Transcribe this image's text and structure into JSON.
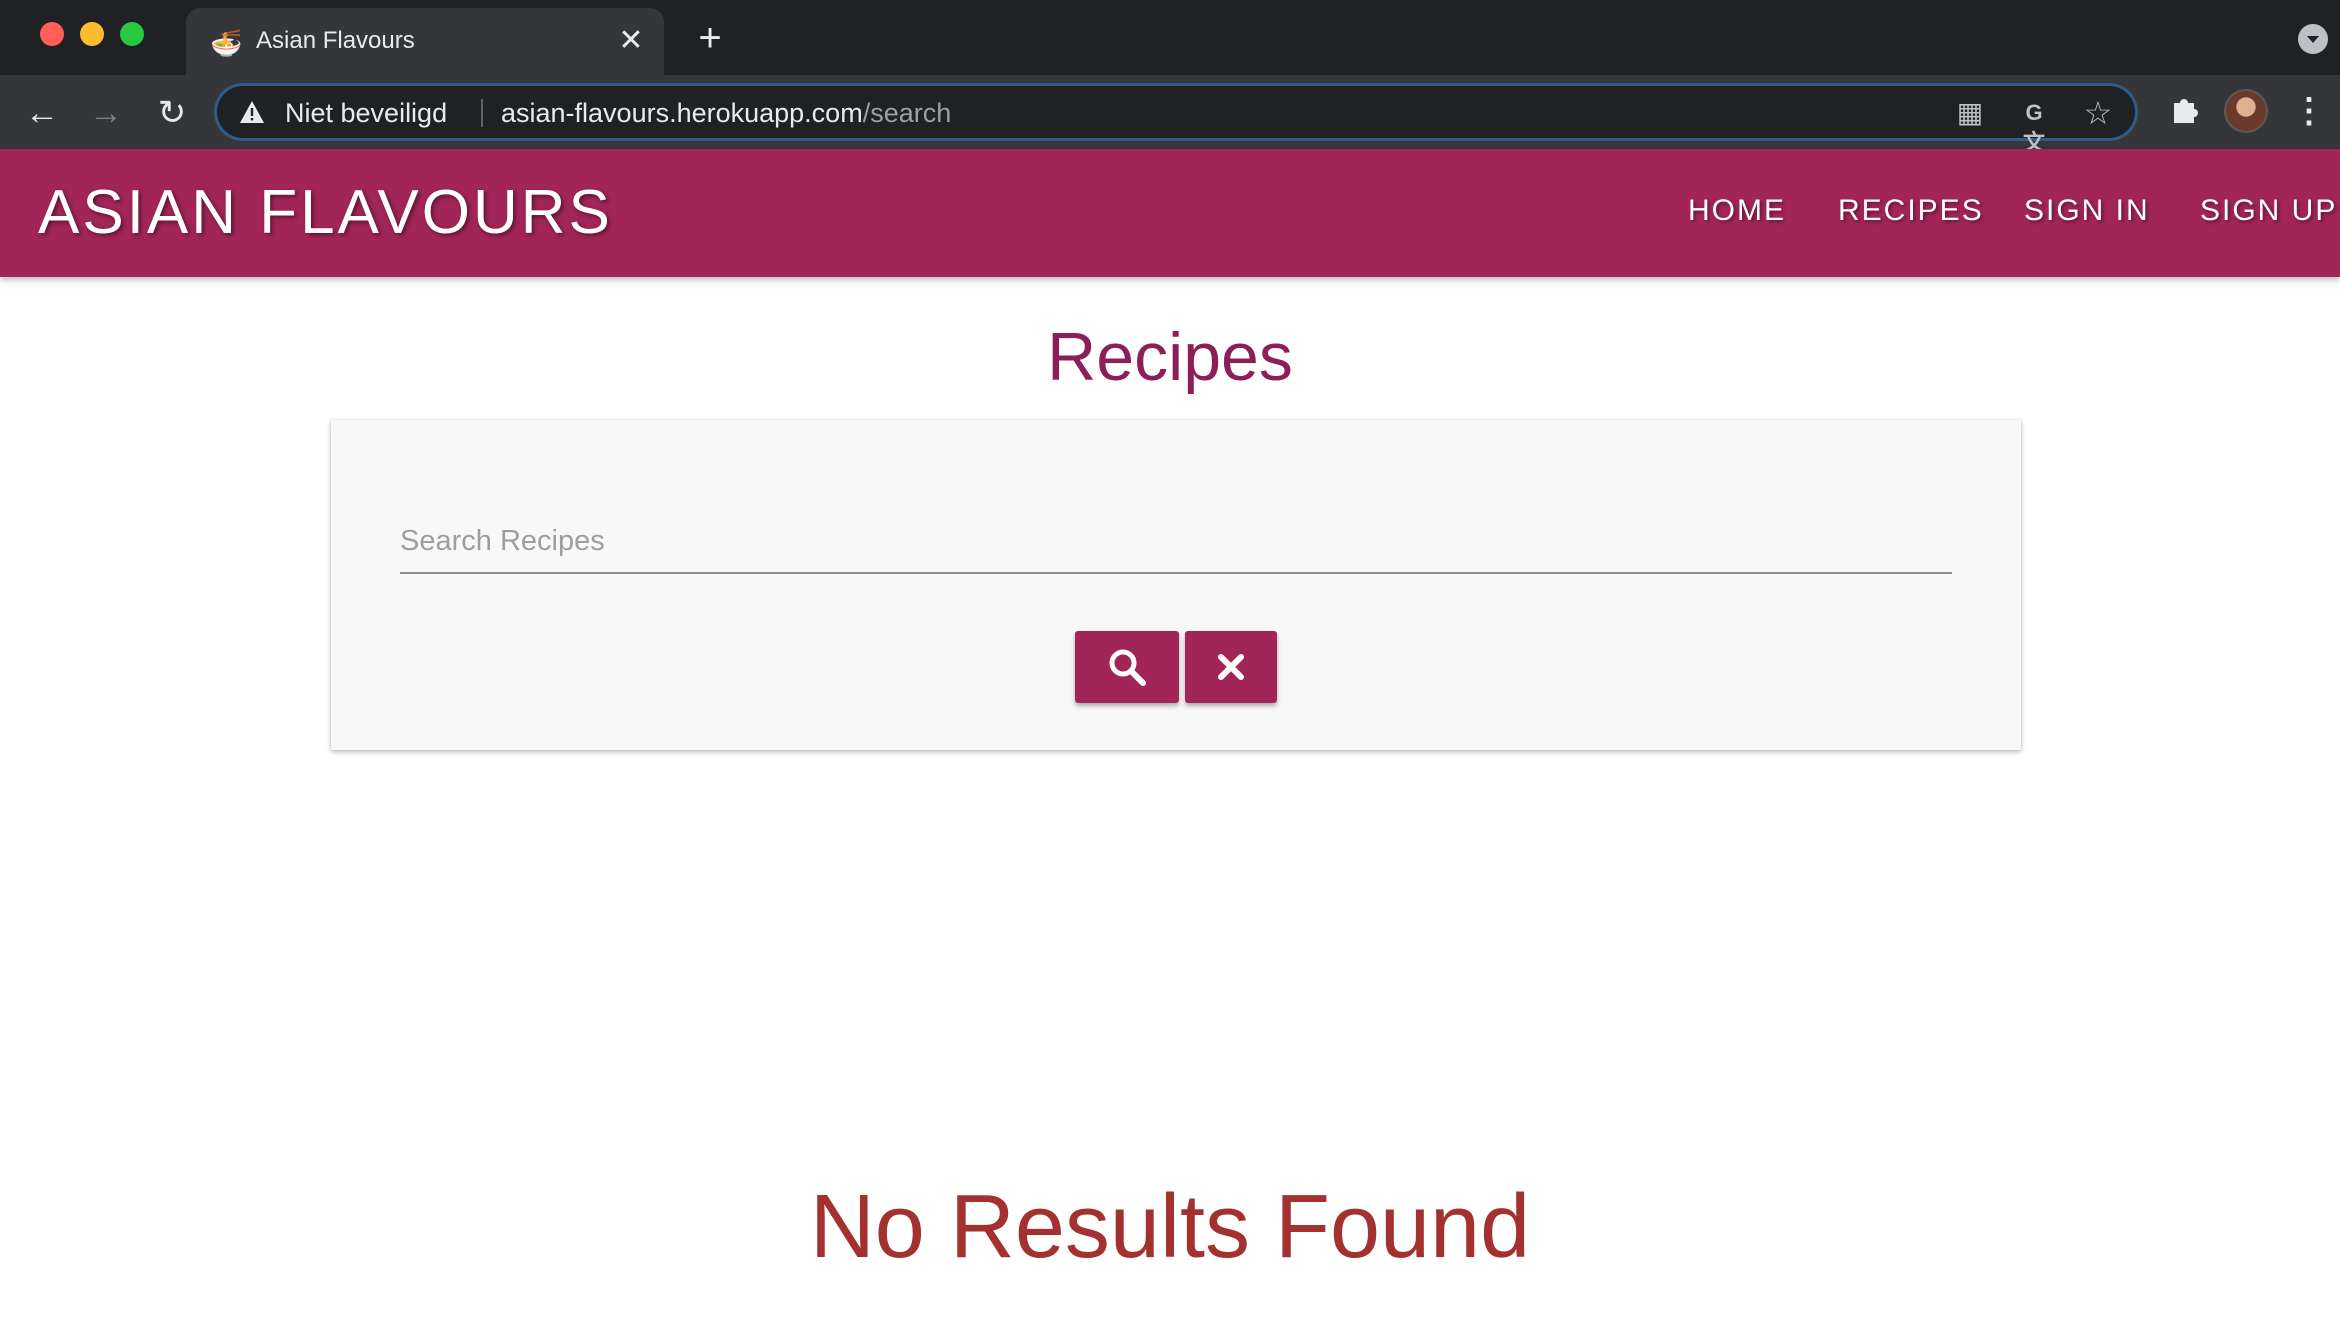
{
  "browser": {
    "tab_title": "Asian Flavours",
    "tab_favicon": "🍜",
    "new_tab_glyph": "+",
    "security_label": "Niet beveiligd",
    "url_host": "asian-flavours.herokuapp.com",
    "url_path": "/search",
    "omnibox_border_color": "#2f5d8a"
  },
  "site": {
    "brand": "ASIAN FLAVOURS",
    "nav": [
      {
        "label": "HOME"
      },
      {
        "label": "RECIPES"
      },
      {
        "label": "SIGN IN"
      },
      {
        "label": "SIGN UP"
      }
    ],
    "accent_color": "#a12557"
  },
  "main": {
    "title": "Recipes",
    "search_placeholder": "Search Recipes",
    "search_value": "",
    "no_results_text": "No Results Found",
    "no_results_color": "#a3312f"
  }
}
